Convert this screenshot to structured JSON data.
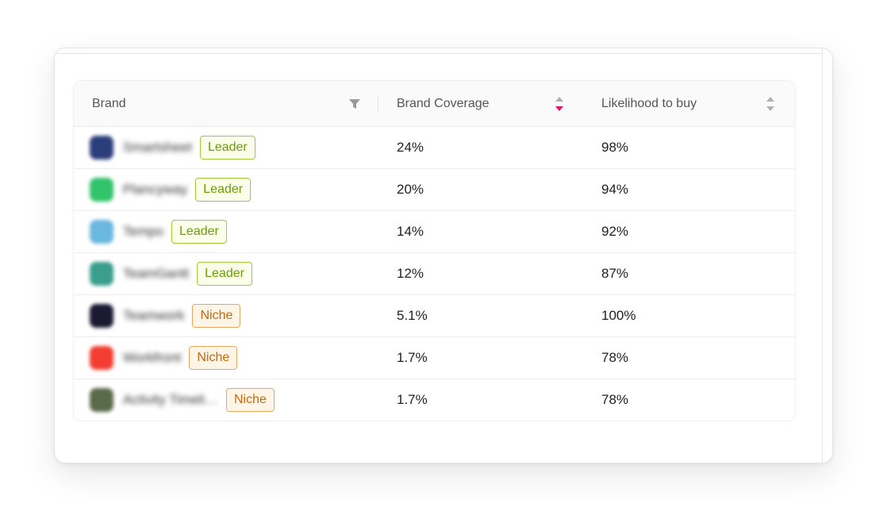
{
  "columns": {
    "brand": "Brand",
    "coverage": "Brand Coverage",
    "likelihood": "Likelihood to buy"
  },
  "rows": [
    {
      "name": "Smartsheet",
      "badge": "Leader",
      "tier": "leader",
      "coverage": "24%",
      "likelihood": "98%",
      "logo_color": "#2b3e7a"
    },
    {
      "name": "Plancyway",
      "badge": "Leader",
      "tier": "leader",
      "coverage": "20%",
      "likelihood": "94%",
      "logo_color": "#31c46b"
    },
    {
      "name": "Tempo",
      "badge": "Leader",
      "tier": "leader",
      "coverage": "14%",
      "likelihood": "92%",
      "logo_color": "#6ab8e0"
    },
    {
      "name": "TeamGantt",
      "badge": "Leader",
      "tier": "leader",
      "coverage": "12%",
      "likelihood": "87%",
      "logo_color": "#3a9e8c"
    },
    {
      "name": "Teamwork",
      "badge": "Niche",
      "tier": "niche",
      "coverage": "5.1%",
      "likelihood": "100%",
      "logo_color": "#1c1a33"
    },
    {
      "name": "Workfront",
      "badge": "Niche",
      "tier": "niche",
      "coverage": "1.7%",
      "likelihood": "78%",
      "logo_color": "#f43d32"
    },
    {
      "name": "Activity Timeli…",
      "badge": "Niche",
      "tier": "niche",
      "coverage": "1.7%",
      "likelihood": "78%",
      "logo_color": "#5a6b4c"
    }
  ],
  "colors": {
    "sort_active": "#e0156e",
    "sort_inactive": "#b0b0b0",
    "filter_icon": "#9a9a9a"
  },
  "sort": {
    "column": "coverage",
    "direction": "descending"
  }
}
